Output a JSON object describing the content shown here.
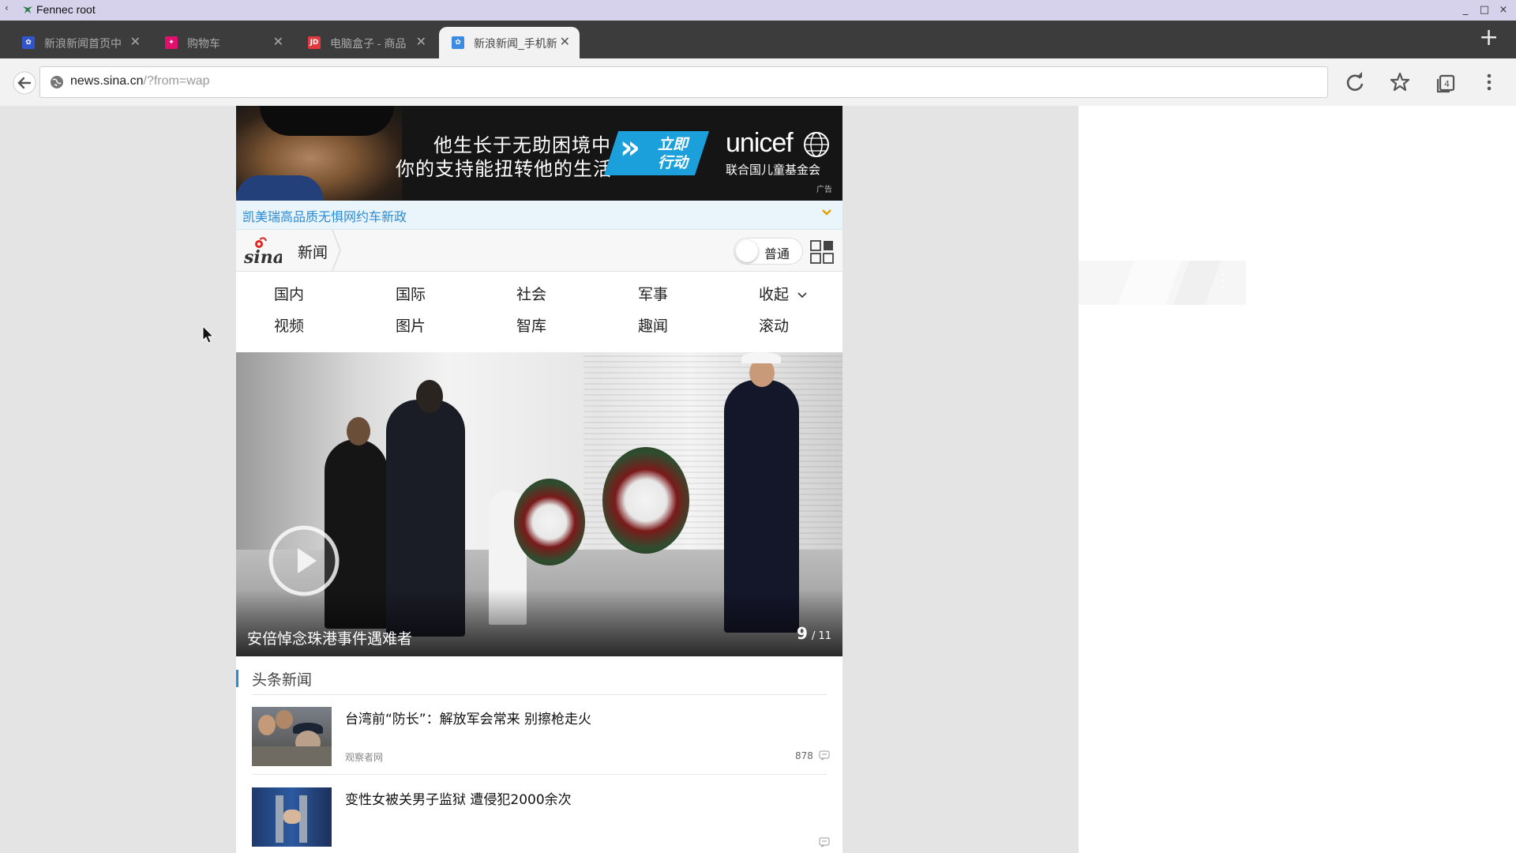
{
  "os_window": {
    "title": "Fennec root",
    "back_glyph": "‹",
    "minimize": "_",
    "maximize": "□",
    "close": "×"
  },
  "tabs": [
    {
      "label": "新浪新闻首页中",
      "favicon": "sina-news-icon",
      "color": "#3355cc",
      "active": false
    },
    {
      "label": "购物车",
      "favicon": "cart-site-icon",
      "color": "#e0116e",
      "active": false
    },
    {
      "label": "电脑盒子 - 商品",
      "favicon": "jd-icon",
      "color": "#e4393c",
      "fav_text": "JD",
      "active": false
    },
    {
      "label": "新浪新闻_手机新浪",
      "favicon": "sina-news-icon",
      "color": "#3d8be0",
      "active": true
    }
  ],
  "tab_close_glyph": "✕",
  "new_tab_glyph": "+",
  "toolbar": {
    "url_host": "news.sina.cn",
    "url_rest": "/?from=wap",
    "tab_count": "4"
  },
  "ad": {
    "line1": "他生长于无助困境中",
    "line2": "你的支持能扭转他的生活",
    "cta_line1": "立即",
    "cta_line2": "行动",
    "chevrons": "»",
    "brand": "unicef",
    "brand_sub": "联合国儿童基金会",
    "ad_label": "广告"
  },
  "notice": {
    "text": "凯美瑞高品质无惧网约车新政"
  },
  "site_header": {
    "channel": "新闻",
    "mode_label": "普通"
  },
  "nav": {
    "row1": [
      "国内",
      "国际",
      "社会",
      "军事",
      "收起"
    ],
    "row2": [
      "视频",
      "图片",
      "智库",
      "趣闻",
      "滚动"
    ]
  },
  "hero": {
    "caption": "安倍悼念珠港事件遇难者",
    "current": "9",
    "total": "/ 11"
  },
  "headlines": {
    "section_title": "头条新闻",
    "items": [
      {
        "title": "台湾前“防长”：解放军会常来 别擦枪走火",
        "source": "观察者网",
        "comments": "878"
      },
      {
        "title": "变性女被关男子监狱 遭侵犯2000余次",
        "source": "",
        "comments": ""
      }
    ]
  },
  "colors": {
    "accent": "#2c8ad4",
    "chrome_dark": "#3c3c3c",
    "os_bar": "#d6d2ec",
    "unicef_blue": "#1ca0dc"
  }
}
